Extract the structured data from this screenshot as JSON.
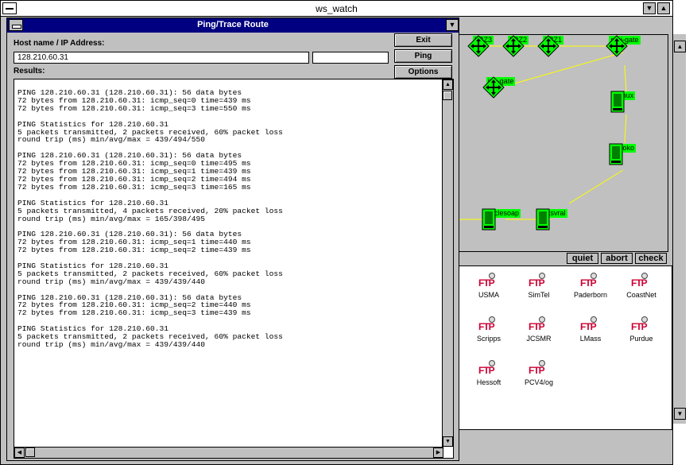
{
  "main_window": {
    "title": "ws_watch"
  },
  "title_buttons": {
    "minimize": "▼",
    "maximize": "▲"
  },
  "network_nodes": [
    {
      "label": "LRZ3",
      "kind": "router"
    },
    {
      "label": "LRZ2",
      "kind": "router"
    },
    {
      "label": "LRZ1",
      "kind": "router"
    },
    {
      "label": "mpi-gate",
      "kind": "router"
    },
    {
      "label": "ipp-gate",
      "kind": "router"
    },
    {
      "label": "linux",
      "kind": "host"
    },
    {
      "label": "zooko",
      "kind": "host"
    },
    {
      "label": "cyclesoap",
      "kind": "host"
    },
    {
      "label": "tuxsvral",
      "kind": "host"
    }
  ],
  "action_buttons": {
    "quiet": "quiet",
    "abort": "abort",
    "check": "check"
  },
  "ftp_sites": [
    {
      "name": "USMA"
    },
    {
      "name": "SimTel"
    },
    {
      "name": "Paderborn"
    },
    {
      "name": "CoastNet"
    },
    {
      "name": "Scripps"
    },
    {
      "name": "JCSMR"
    },
    {
      "name": "LMass"
    },
    {
      "name": "Purdue"
    },
    {
      "name": "Hessoft"
    },
    {
      "name": "PCV4/og"
    }
  ],
  "ftp_icon_text": "FTP",
  "ping_dialog": {
    "title": "Ping/Trace Route",
    "host_label": "Host name / IP Address:",
    "host_value": "128.210.60.31",
    "results_label": "Results:",
    "buttons": {
      "exit": "Exit",
      "ping": "Ping",
      "options": "Options"
    },
    "results_text": "PING 128.210.60.31 (128.210.60.31): 56 data bytes\n72 bytes from 128.210.60.31: icmp_seq=0 time=439 ms\n72 bytes from 128.210.60.31: icmp_seq=3 time=550 ms\n\nPING Statistics for 128.210.60.31\n5 packets transmitted, 2 packets received, 60% packet loss\nround trip (ms) min/avg/max = 439/494/550\n\nPING 128.210.60.31 (128.210.60.31): 56 data bytes\n72 bytes from 128.210.60.31: icmp_seq=0 time=495 ms\n72 bytes from 128.210.60.31: icmp_seq=1 time=439 ms\n72 bytes from 128.210.60.31: icmp_seq=2 time=494 ms\n72 bytes from 128.210.60.31: icmp_seq=3 time=165 ms\n\nPING Statistics for 128.210.60.31\n5 packets transmitted, 4 packets received, 20% packet loss\nround trip (ms) min/avg/max = 165/398/495\n\nPING 128.210.60.31 (128.210.60.31): 56 data bytes\n72 bytes from 128.210.60.31: icmp_seq=1 time=440 ms\n72 bytes from 128.210.60.31: icmp_seq=2 time=439 ms\n\nPING Statistics for 128.210.60.31\n5 packets transmitted, 2 packets received, 60% packet loss\nround trip (ms) min/avg/max = 439/439/440\n\nPING 128.210.60.31 (128.210.60.31): 56 data bytes\n72 bytes from 128.210.60.31: icmp_seq=2 time=440 ms\n72 bytes from 128.210.60.31: icmp_seq=3 time=439 ms\n\nPING Statistics for 128.210.60.31\n5 packets transmitted, 2 packets received, 60% packet loss\nround trip (ms) min/avg/max = 439/439/440"
  },
  "colors": {
    "node_green": "#00ff00",
    "link_yellow": "#ffff00",
    "dialog_title_bg": "#000080",
    "ftp_red": "#cc0033"
  }
}
